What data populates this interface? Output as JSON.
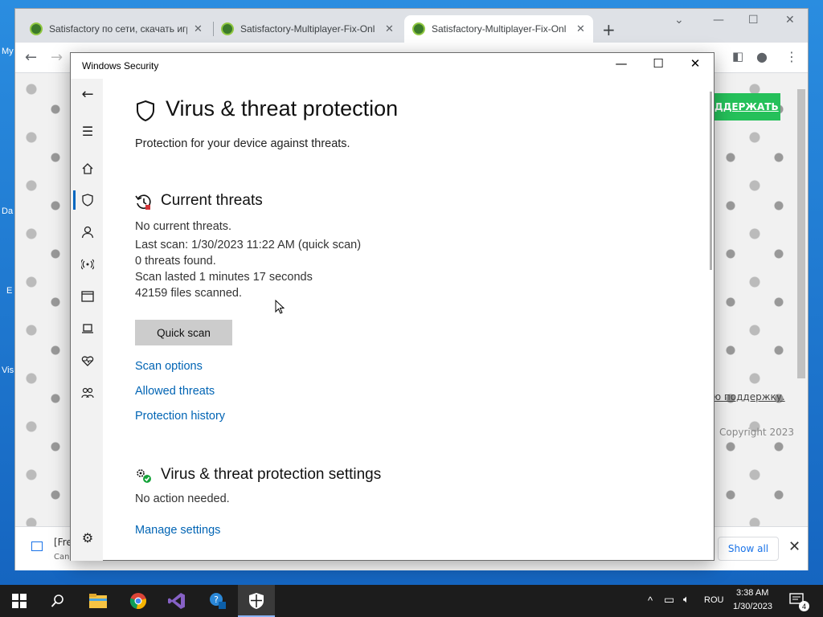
{
  "desktop": {
    "icon_labels": [
      "My",
      "Da",
      "E",
      "Vis"
    ]
  },
  "browser": {
    "tabs": [
      {
        "title": "Satisfactory по сети, скачать игр",
        "active": false
      },
      {
        "title": "Satisfactory-Multiplayer-Fix-Onl",
        "active": false
      },
      {
        "title": "Satisfactory-Multiplayer-Fix-Onl",
        "active": true
      }
    ],
    "page": {
      "green_button": "ДДЕРЖАТЬ",
      "support_link": "ю поддержку.",
      "copyright": "Copyright 2023"
    },
    "download_bar": {
      "item_name": "[Fre",
      "item_status": "Canc",
      "show_all": "Show all"
    }
  },
  "security_window": {
    "title": "Windows Security",
    "heading": "Virus & threat protection",
    "subtitle": "Protection for your device against threats.",
    "current_threats": {
      "heading": "Current threats",
      "status": "No current threats.",
      "last_scan": "Last scan: 1/30/2023 11:22 AM (quick scan)",
      "threats_found": "0 threats found.",
      "duration": "Scan lasted 1 minutes 17 seconds",
      "files_scanned": "42159 files scanned."
    },
    "quick_scan_button": "Quick scan",
    "links": [
      "Scan options",
      "Allowed threats",
      "Protection history"
    ],
    "settings": {
      "heading": "Virus & threat protection settings",
      "status": "No action needed.",
      "manage_link": "Manage settings"
    },
    "nav_icons": [
      "back-icon",
      "menu-icon",
      "home-icon",
      "shield-icon",
      "account-icon",
      "firewall-icon",
      "app-browser-icon",
      "device-security-icon",
      "health-icon",
      "family-icon",
      "settings-icon"
    ]
  },
  "taskbar": {
    "language": "ROU",
    "time": "3:38 AM",
    "date": "1/30/2023",
    "notification_count": "4"
  },
  "colors": {
    "link": "#0064b4",
    "accent": "#0067c0",
    "green": "#25c05a",
    "taskbar": "#1c1c1c"
  }
}
